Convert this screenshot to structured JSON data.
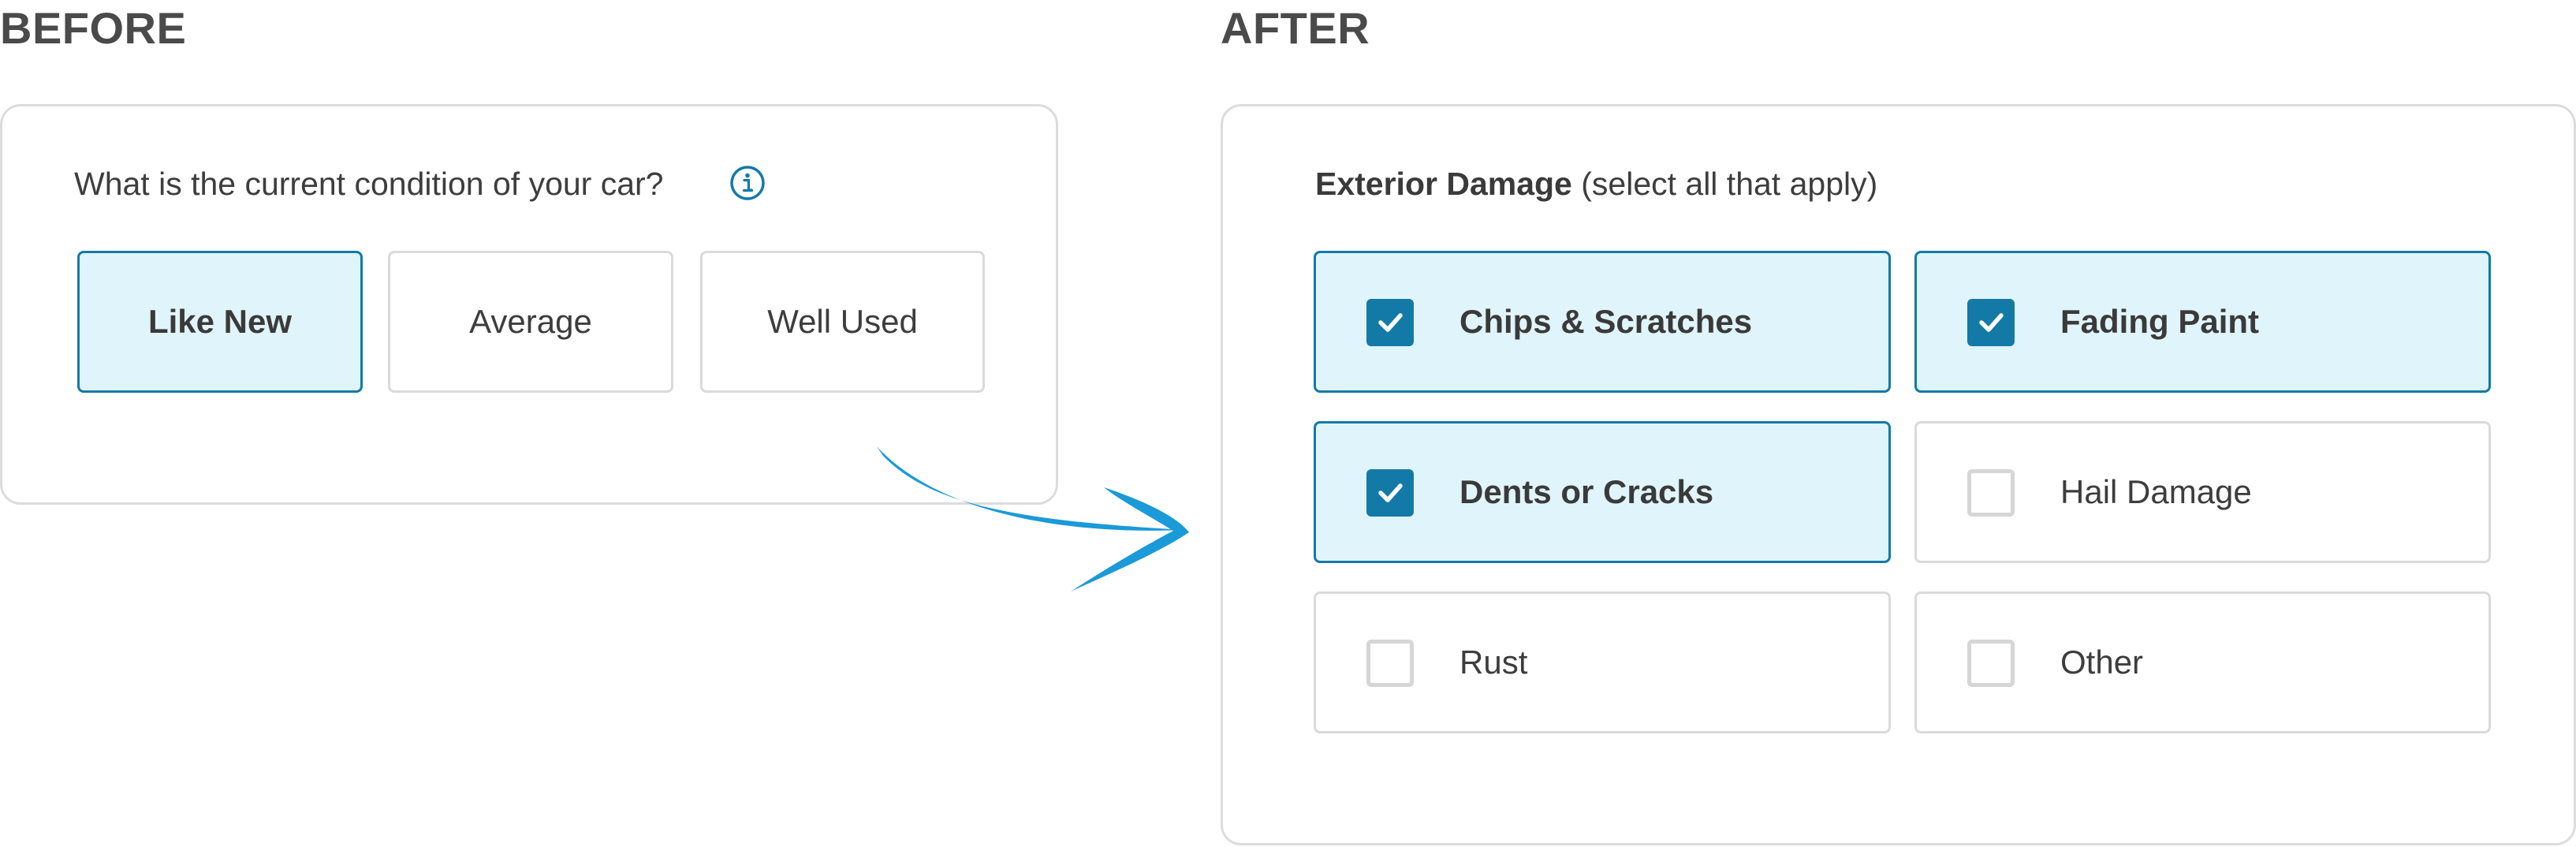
{
  "before": {
    "heading": "BEFORE",
    "question": "What is the current condition of your car?",
    "options": [
      {
        "label": "Like New",
        "selected": true
      },
      {
        "label": "Average",
        "selected": false
      },
      {
        "label": "Well Used",
        "selected": false
      }
    ]
  },
  "after": {
    "heading": "AFTER",
    "question_bold": "Exterior Damage",
    "question_rest": " (select all that apply)",
    "options": [
      {
        "label": "Chips & Scratches",
        "checked": true
      },
      {
        "label": "Fading Paint",
        "checked": true
      },
      {
        "label": "Dents or Cracks",
        "checked": true
      },
      {
        "label": "Hail Damage",
        "checked": false
      },
      {
        "label": "Rust",
        "checked": false
      },
      {
        "label": "Other",
        "checked": false
      }
    ]
  },
  "icons": {
    "info": "info-icon",
    "transition": "curved-arrow-icon",
    "check": "checkmark-icon"
  },
  "colors": {
    "accent": "#137aa7",
    "selected_bg": "#e0f5fb",
    "arrow": "#1a9ad8",
    "border": "#dadada",
    "heading": "#4a4a4a"
  }
}
